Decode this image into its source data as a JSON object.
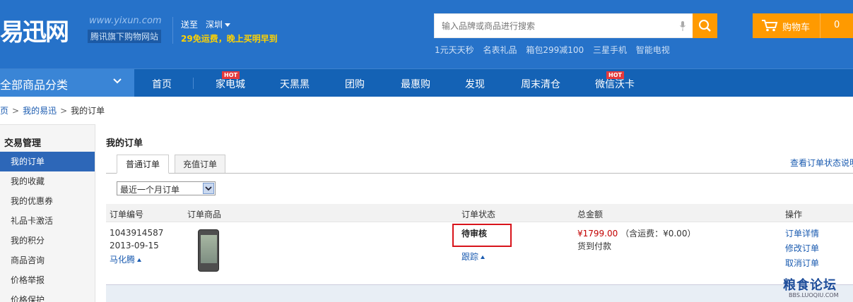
{
  "header": {
    "logo_text": "易迅网",
    "logo_url": "www.yixun.com",
    "logo_subtitle": "腾讯旗下购物网站",
    "deliver_label": "送至",
    "deliver_city": "深圳",
    "promo": "29免运费，晚上买明早到",
    "search_placeholder": "输入品牌或商品进行搜索",
    "hot_words": [
      "1元天天秒",
      "名表礼品",
      "箱包299减100",
      "三星手机",
      "智能电视"
    ],
    "cart_label": "购物车",
    "cart_count": "0",
    "colors": {
      "brand_blue": "#2672c9",
      "accent_orange": "#ff9a00",
      "promo_yellow": "#ffd200"
    }
  },
  "nav": {
    "all_categories": "全部商品分类",
    "hot_badge": "HOT",
    "items": [
      {
        "label": "首页",
        "hot": false
      },
      {
        "label": "家电城",
        "hot": true
      },
      {
        "label": "天黑黑",
        "hot": false
      },
      {
        "label": "团购",
        "hot": false
      },
      {
        "label": "最惠购",
        "hot": false
      },
      {
        "label": "发现",
        "hot": false
      },
      {
        "label": "周末清仓",
        "hot": false
      },
      {
        "label": "微信沃卡",
        "hot": true
      }
    ]
  },
  "breadcrumb": [
    "页",
    "我的易迅",
    "我的订单"
  ],
  "sidebar": {
    "title": "交易管理",
    "items": [
      "我的订单",
      "我的收藏",
      "我的优惠券",
      "礼品卡激活",
      "我的积分",
      "商品咨询",
      "价格举报",
      "价格保护"
    ],
    "active_index": 0
  },
  "main": {
    "title": "我的订单",
    "tabs": [
      "普通订单",
      "充值订单"
    ],
    "active_tab": 0,
    "status_help_link": "查看订单状态说明",
    "period_select": "最近一个月订单",
    "columns": [
      "订单编号",
      "订单商品",
      "订单状态",
      "总金额",
      "操作"
    ],
    "order": {
      "id": "1043914587",
      "date": "2013-09-15",
      "buyer": "马化腾",
      "status": "待审核",
      "track": "跟踪",
      "amount": "¥1799.00",
      "shipping": "（含运费：¥0.00）",
      "payment": "货到付款",
      "actions": [
        "订单详情",
        "修改订单",
        "取消订单"
      ]
    }
  },
  "watermark": {
    "text": "粮食论坛",
    "sub": "BBS.LUOQIU.COM"
  }
}
